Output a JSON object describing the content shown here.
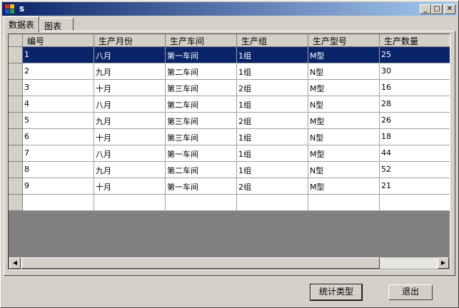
{
  "window": {
    "title": "s"
  },
  "title_buttons": {
    "minimize": "_",
    "maximize": "□",
    "close": "✕"
  },
  "tabs": [
    {
      "label": "数据表"
    },
    {
      "label": "图表"
    }
  ],
  "table": {
    "columns": [
      "编号",
      "生产月份",
      "生产车间",
      "生产组",
      "生产型号",
      "生产数量"
    ],
    "rows": [
      [
        "1",
        "八月",
        "第一车间",
        "1组",
        "M型",
        "25"
      ],
      [
        "2",
        "九月",
        "第二车间",
        "1组",
        "N型",
        "30"
      ],
      [
        "3",
        "十月",
        "第三车间",
        "2组",
        "M型",
        "16"
      ],
      [
        "4",
        "八月",
        "第二车间",
        "1组",
        "N型",
        "28"
      ],
      [
        "5",
        "九月",
        "第三车间",
        "2组",
        "M型",
        "26"
      ],
      [
        "6",
        "十月",
        "第三车间",
        "1组",
        "N型",
        "18"
      ],
      [
        "7",
        "八月",
        "第一车间",
        "1组",
        "M型",
        "44"
      ],
      [
        "8",
        "九月",
        "第二车间",
        "1组",
        "N型",
        "52"
      ],
      [
        "9",
        "十月",
        "第一车间",
        "2组",
        "M型",
        "21"
      ]
    ],
    "selected_row": 0
  },
  "buttons": {
    "stats": "统计类型",
    "exit": "退出"
  }
}
